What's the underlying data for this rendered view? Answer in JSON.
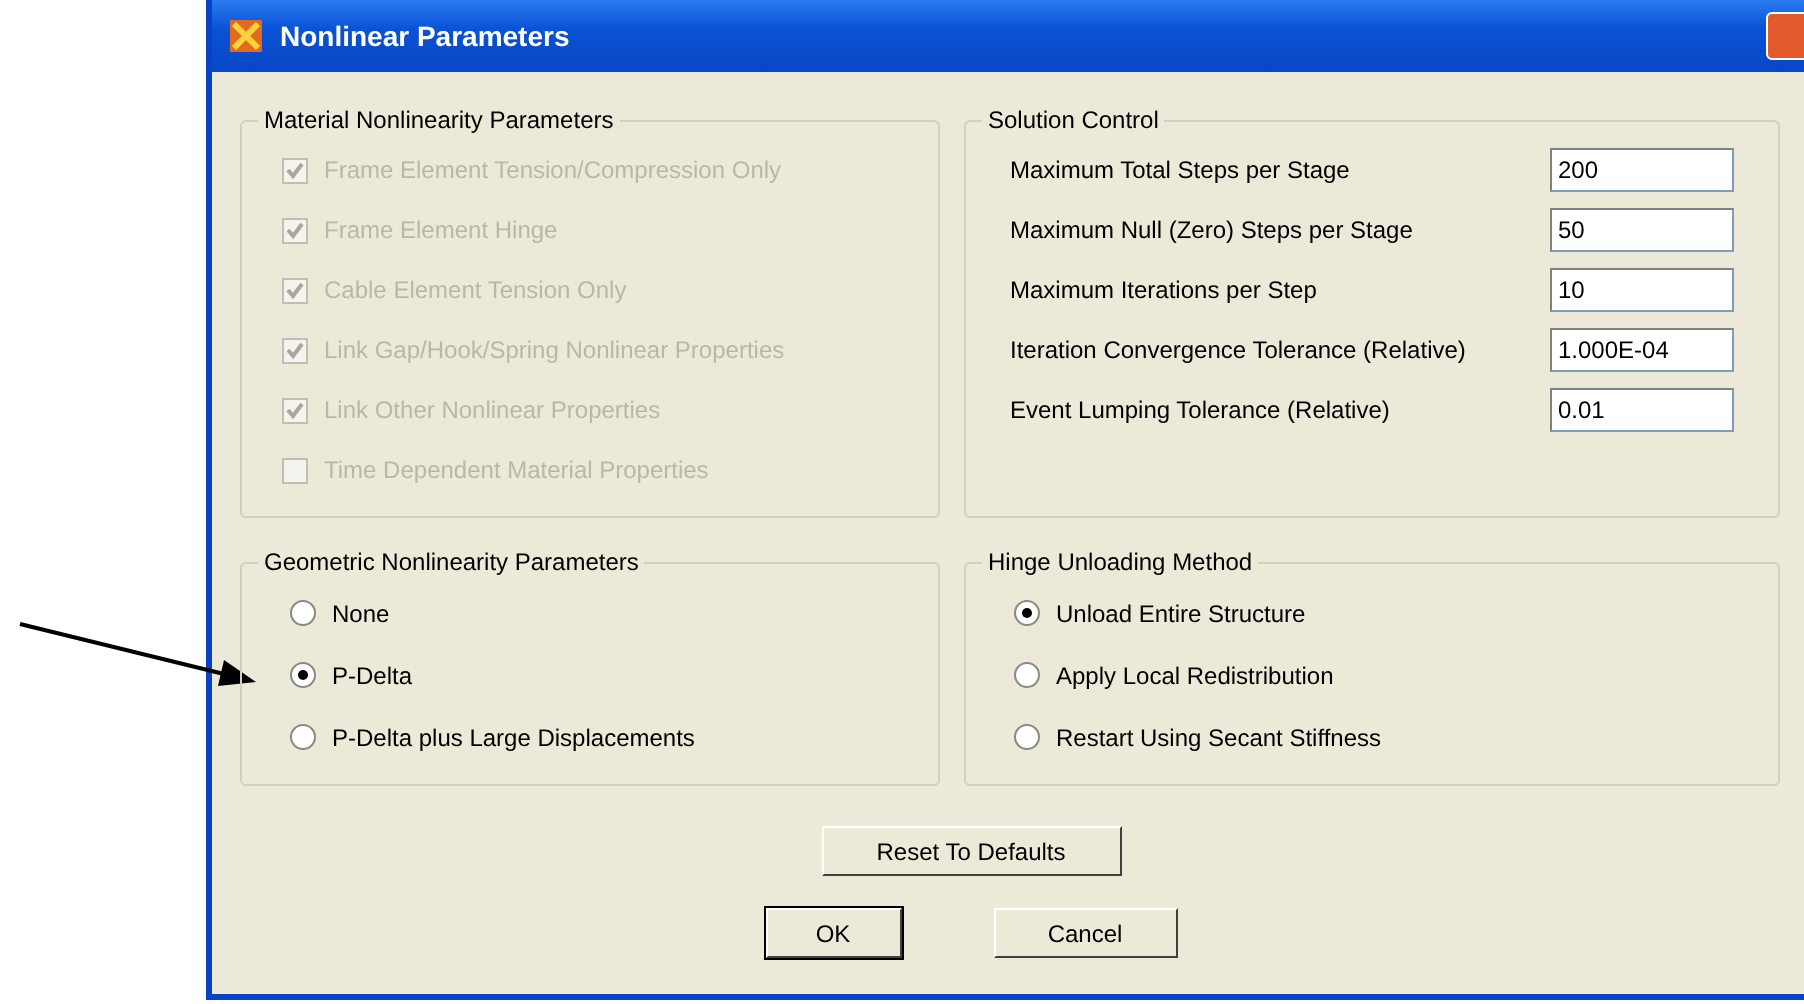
{
  "window": {
    "title": "Nonlinear Parameters"
  },
  "material_group": {
    "title": "Material Nonlinearity Parameters",
    "items": [
      {
        "label": "Frame Element Tension/Compression Only",
        "checked": true,
        "disabled": true
      },
      {
        "label": "Frame Element Hinge",
        "checked": true,
        "disabled": true
      },
      {
        "label": "Cable Element Tension Only",
        "checked": true,
        "disabled": true
      },
      {
        "label": "Link Gap/Hook/Spring Nonlinear Properties",
        "checked": true,
        "disabled": true
      },
      {
        "label": "Link Other Nonlinear Properties",
        "checked": true,
        "disabled": true
      },
      {
        "label": "Time Dependent Material Properties",
        "checked": false,
        "disabled": true
      }
    ]
  },
  "solution_group": {
    "title": "Solution Control",
    "fields": [
      {
        "label": "Maximum Total Steps per Stage",
        "value": "200"
      },
      {
        "label": "Maximum Null (Zero) Steps per Stage",
        "value": "50"
      },
      {
        "label": "Maximum Iterations per Step",
        "value": "10"
      },
      {
        "label": "Iteration Convergence Tolerance (Relative)",
        "value": "1.000E-04"
      },
      {
        "label": "Event Lumping Tolerance (Relative)",
        "value": "0.01"
      }
    ]
  },
  "geometric_group": {
    "title": "Geometric Nonlinearity Parameters",
    "options": [
      {
        "label": "None",
        "selected": false
      },
      {
        "label": "P-Delta",
        "selected": true
      },
      {
        "label": "P-Delta plus Large Displacements",
        "selected": false
      }
    ]
  },
  "hinge_group": {
    "title": "Hinge Unloading Method",
    "options": [
      {
        "label": "Unload Entire Structure",
        "selected": true
      },
      {
        "label": "Apply Local Redistribution",
        "selected": false
      },
      {
        "label": "Restart Using Secant Stiffness",
        "selected": false
      }
    ]
  },
  "buttons": [
    {
      "label": "Reset To Defaults",
      "kind": "reset",
      "default": false
    },
    {
      "label": "OK",
      "kind": "action",
      "default": true
    },
    {
      "label": "Cancel",
      "kind": "action",
      "default": false
    }
  ]
}
